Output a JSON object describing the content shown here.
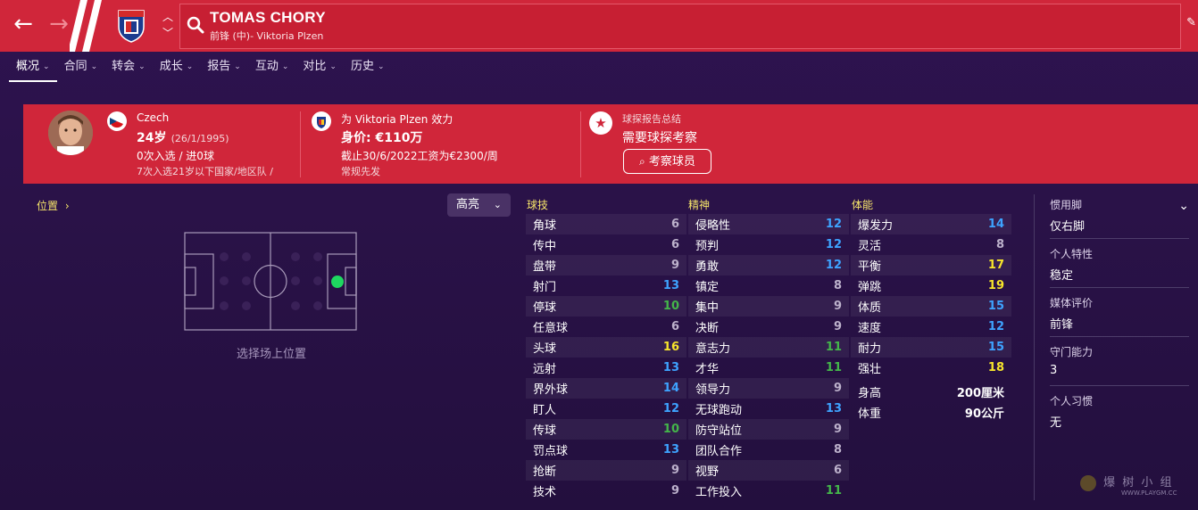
{
  "header": {
    "back_icon": "←",
    "forward_icon": "→",
    "player_name": "TOMAS CHORY",
    "player_subtitle": "前锋 (中)- Viktoria Plzen"
  },
  "tabs": [
    {
      "label": "概况",
      "active": true
    },
    {
      "label": "合同"
    },
    {
      "label": "转会"
    },
    {
      "label": "成长"
    },
    {
      "label": "报告"
    },
    {
      "label": "互动"
    },
    {
      "label": "对比"
    },
    {
      "label": "历史"
    }
  ],
  "card": {
    "nationality": "Czech",
    "age": "24岁",
    "dob": "(26/1/1995)",
    "caps": "0次入选 / 进0球",
    "youth_caps": "7次入选21岁以下国家/地区队 /",
    "club_line": "为 Viktoria Plzen 效力",
    "value": "身价: €110万",
    "contract": "截止30/6/2022工资为€2300/周",
    "role": "常规先发",
    "scout_title": "球探报告总结",
    "scout_status": "需要球探考察",
    "scout_button": "考察球员"
  },
  "position_panel": {
    "link": "位置",
    "highlight_label": "高亮",
    "caption": "选择场上位置"
  },
  "attributes": {
    "technical": {
      "title": "球技",
      "rows": [
        {
          "name": "角球",
          "value": "6",
          "tier": "grey"
        },
        {
          "name": "传中",
          "value": "6",
          "tier": "grey"
        },
        {
          "name": "盘带",
          "value": "9",
          "tier": "grey"
        },
        {
          "name": "射门",
          "value": "13",
          "tier": "blue"
        },
        {
          "name": "停球",
          "value": "10",
          "tier": "green"
        },
        {
          "name": "任意球",
          "value": "6",
          "tier": "grey"
        },
        {
          "name": "头球",
          "value": "16",
          "tier": "yellow"
        },
        {
          "name": "远射",
          "value": "13",
          "tier": "blue"
        },
        {
          "name": "界外球",
          "value": "14",
          "tier": "blue"
        },
        {
          "name": "盯人",
          "value": "12",
          "tier": "blue"
        },
        {
          "name": "传球",
          "value": "10",
          "tier": "green"
        },
        {
          "name": "罚点球",
          "value": "13",
          "tier": "blue"
        },
        {
          "name": "抢断",
          "value": "9",
          "tier": "grey"
        },
        {
          "name": "技术",
          "value": "9",
          "tier": "grey"
        }
      ]
    },
    "mental": {
      "title": "精神",
      "rows": [
        {
          "name": "侵略性",
          "value": "12",
          "tier": "blue"
        },
        {
          "name": "预判",
          "value": "12",
          "tier": "blue"
        },
        {
          "name": "勇敢",
          "value": "12",
          "tier": "blue"
        },
        {
          "name": "镇定",
          "value": "8",
          "tier": "grey"
        },
        {
          "name": "集中",
          "value": "9",
          "tier": "grey"
        },
        {
          "name": "决断",
          "value": "9",
          "tier": "grey"
        },
        {
          "name": "意志力",
          "value": "11",
          "tier": "green"
        },
        {
          "name": "才华",
          "value": "11",
          "tier": "green"
        },
        {
          "name": "领导力",
          "value": "9",
          "tier": "grey"
        },
        {
          "name": "无球跑动",
          "value": "13",
          "tier": "blue"
        },
        {
          "name": "防守站位",
          "value": "9",
          "tier": "grey"
        },
        {
          "name": "团队合作",
          "value": "8",
          "tier": "grey"
        },
        {
          "name": "视野",
          "value": "6",
          "tier": "grey"
        },
        {
          "name": "工作投入",
          "value": "11",
          "tier": "green"
        }
      ]
    },
    "physical": {
      "title": "体能",
      "rows": [
        {
          "name": "爆发力",
          "value": "14",
          "tier": "blue"
        },
        {
          "name": "灵活",
          "value": "8",
          "tier": "grey"
        },
        {
          "name": "平衡",
          "value": "17",
          "tier": "yellow"
        },
        {
          "name": "弹跳",
          "value": "19",
          "tier": "yellow"
        },
        {
          "name": "体质",
          "value": "15",
          "tier": "blue"
        },
        {
          "name": "速度",
          "value": "12",
          "tier": "blue"
        },
        {
          "name": "耐力",
          "value": "15",
          "tier": "blue"
        },
        {
          "name": "强壮",
          "value": "18",
          "tier": "yellow"
        }
      ],
      "height_label": "身高",
      "height_value": "200厘米",
      "weight_label": "体重",
      "weight_value": "90公斤"
    }
  },
  "side_panel": {
    "foot_label": "惯用脚",
    "foot_value": "仅右脚",
    "traits_label": "个人特性",
    "traits_value": "稳定",
    "media_label": "媒体评价",
    "media_value": "前锋",
    "defense_label": "守门能力",
    "defense_value": "3",
    "habits_label": "个人习惯",
    "habits_value": "无"
  },
  "watermark": "爆 树 小 组",
  "watermark_url": "WWW.PLAYGM.CC",
  "colors": {
    "header_red": "#d0263a",
    "background_purple": "#2a1248",
    "grey": "#bdb2cc",
    "blue": "#3ea3ff",
    "green": "#44b64a",
    "yellow": "#f7e52b",
    "position_dot": "#1ed760"
  }
}
